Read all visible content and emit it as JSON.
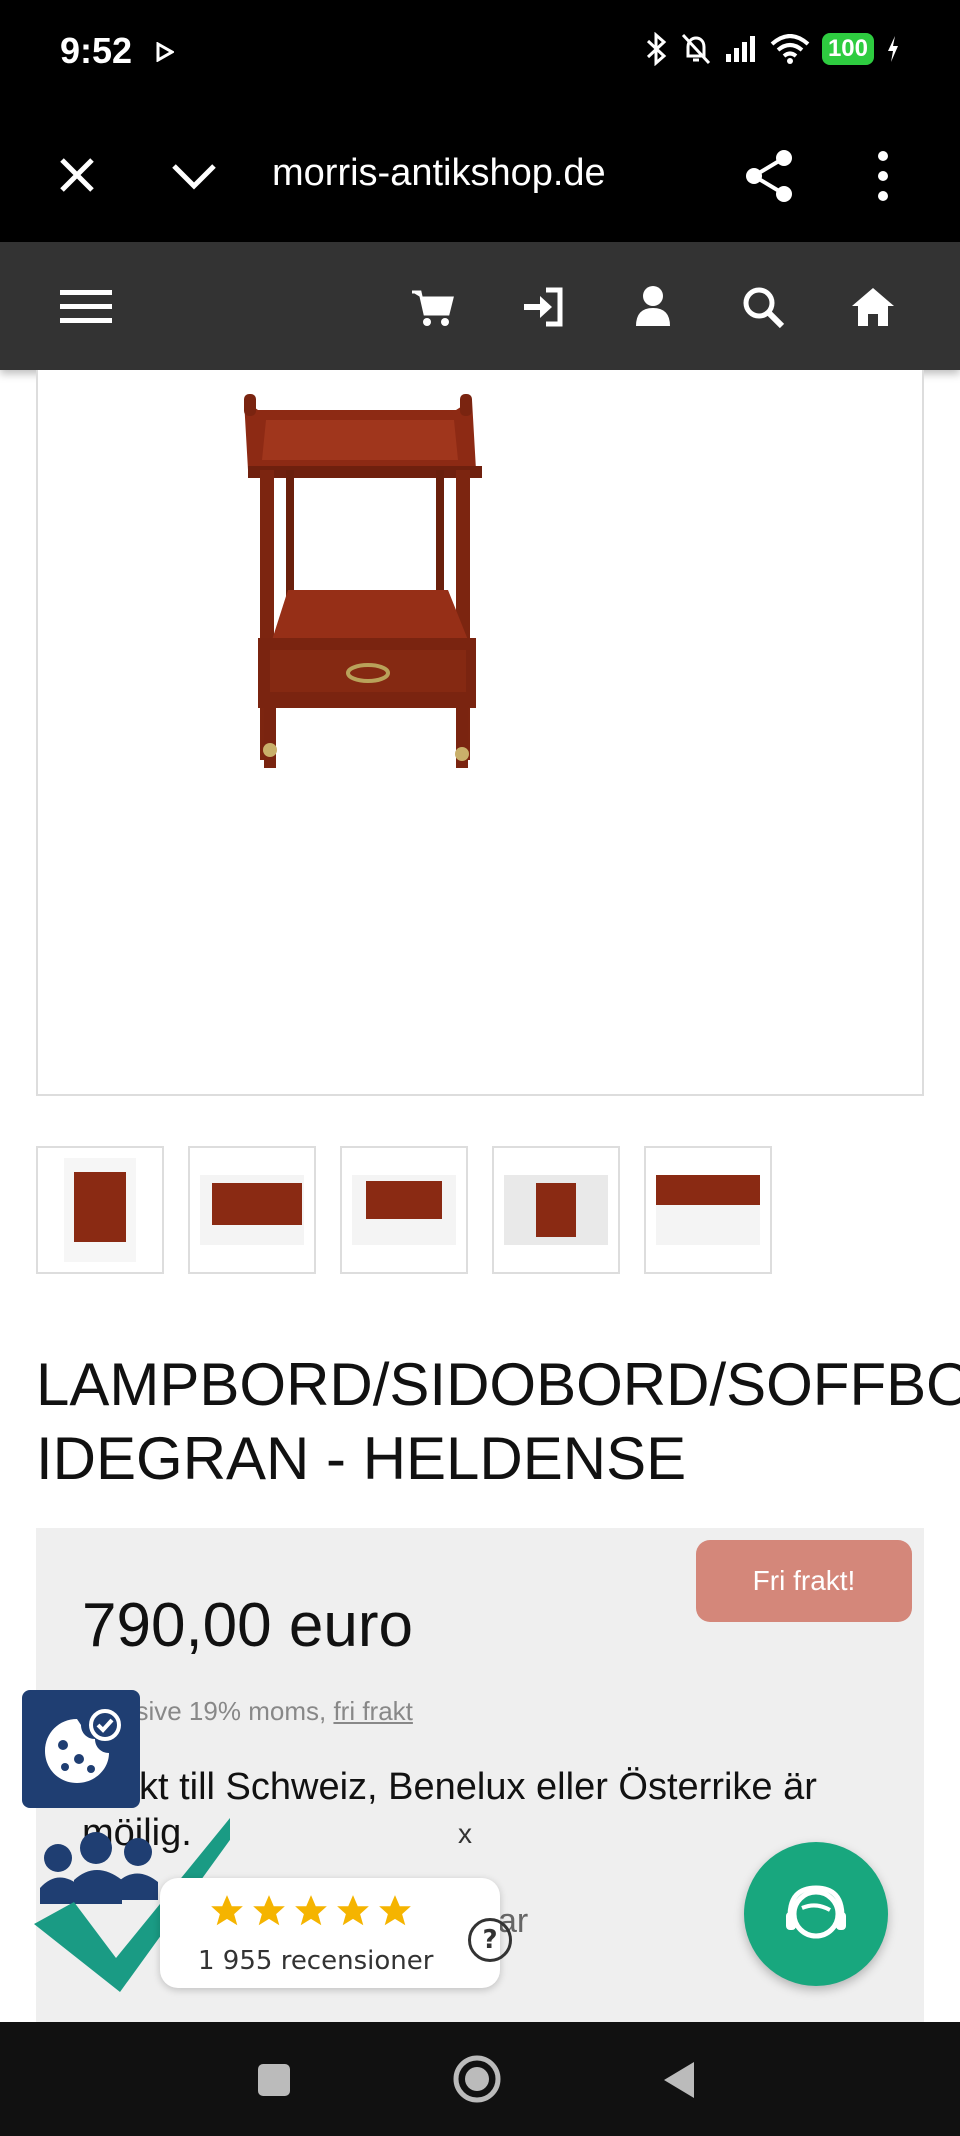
{
  "status_bar": {
    "time": "9:52",
    "battery": "100",
    "icons": [
      "play-icon",
      "bluetooth-icon",
      "bell-off-icon",
      "signal-icon",
      "wifi-icon",
      "charging-icon"
    ]
  },
  "browser": {
    "url": "morris-antikshop.de",
    "icons": [
      "close-icon",
      "chevron-down-icon",
      "share-icon",
      "more-vertical-icon"
    ]
  },
  "site_nav": {
    "icons": [
      "menu-icon",
      "cart-icon",
      "login-icon",
      "user-icon",
      "search-icon",
      "home-icon"
    ],
    "background": "#333333"
  },
  "product": {
    "title_line1": "LAMPBORD/SIDOBORD/SOFFBORD I",
    "title_line2": "IDEGRAN - HELDENSE",
    "thumbnail_count": 5
  },
  "pricing": {
    "free_shipping_label": "Fri frakt!",
    "price": "790,00 euro",
    "vat_prefix": "inklusive 19% moms,",
    "vat_link": "fri frakt",
    "shipping_note": "Frakt till Schweiz, Benelux eller Österrike är möjlig.",
    "trailing_text": "ar",
    "accent_color": "#d4877a"
  },
  "review_widget": {
    "count_label": "1 955 recensioner",
    "stars": 5,
    "close_label": "x",
    "help_label": "?"
  },
  "chat": {
    "color": "#18a77e"
  }
}
